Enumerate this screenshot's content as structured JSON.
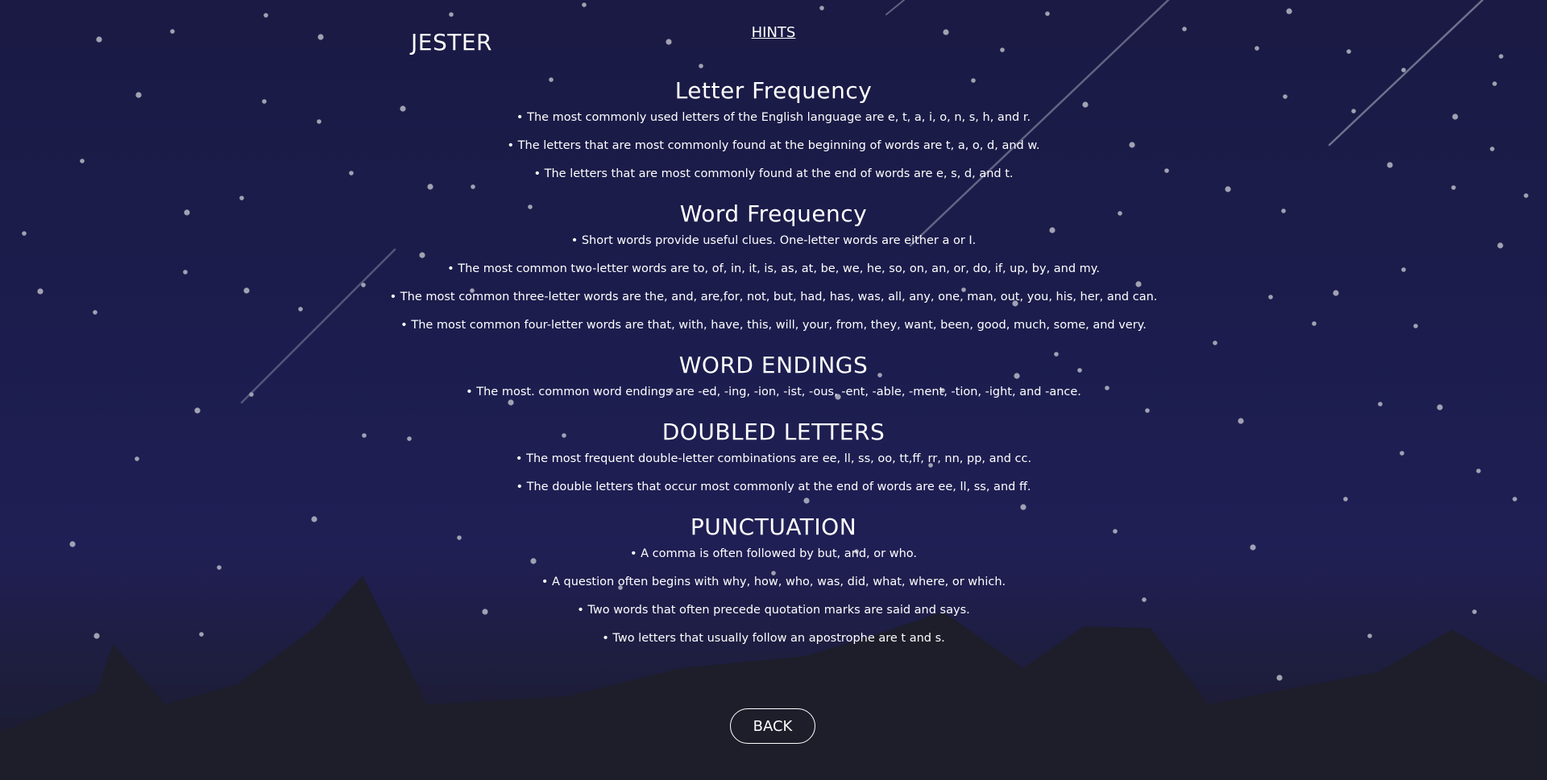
{
  "header": {
    "logo": "JESTER",
    "nav_link": "HINTS"
  },
  "sections": [
    {
      "title": "Letter Frequency",
      "items": [
        "• The most commonly used letters of the English language are e, t, a, i, o, n, s, h, and r.",
        "• The letters that are most commonly found at the beginning of words are t, a, o, d, and w.",
        "• The letters that are most commonly found at the end of words are e, s, d, and t."
      ]
    },
    {
      "title": "Word Frequency",
      "items": [
        "• Short words provide useful clues. One-letter words are either a or I.",
        "• The most common two-letter words are to, of, in, it, is, as, at, be, we, he, so, on, an, or, do, if, up, by, and my.",
        "• The most common three-letter words are the, and, are,for, not, but, had, has, was, all, any, one, man, out, you, his, her, and can.",
        "• The most common four-letter words are that, with, have, this, will, your, from, they, want, been, good, much, some, and very."
      ]
    },
    {
      "title": "WORD ENDINGS",
      "items": [
        "• The most. common word endings are -ed, -ing, -ion, -ist, -ous, -ent, -able, -ment, -tion, -ight, and -ance."
      ]
    },
    {
      "title": "DOUBLED LETTERS",
      "items": [
        "• The most frequent double-letter combinations are ee, ll, ss, oo, tt,ff, rr, nn, pp, and cc.",
        "• The double letters that occur most commonly at the end of words are ee, ll, ss, and ff."
      ]
    },
    {
      "title": "PUNCTUATION",
      "items": [
        "• A comma is often followed by but, and, or who.",
        "• A question often begins with why, how, who, was, did, what, where, or which.",
        "• Two words that often precede quotation marks are said and says.",
        "• Two letters that usually follow an apostrophe are t and s."
      ]
    }
  ],
  "footer": {
    "back_label": "BACK"
  },
  "colors": {
    "sky_top": "#1a1a44",
    "sky_mid": "#1f2055",
    "mountains": "#1d1e2a",
    "text": "#ffffff"
  }
}
